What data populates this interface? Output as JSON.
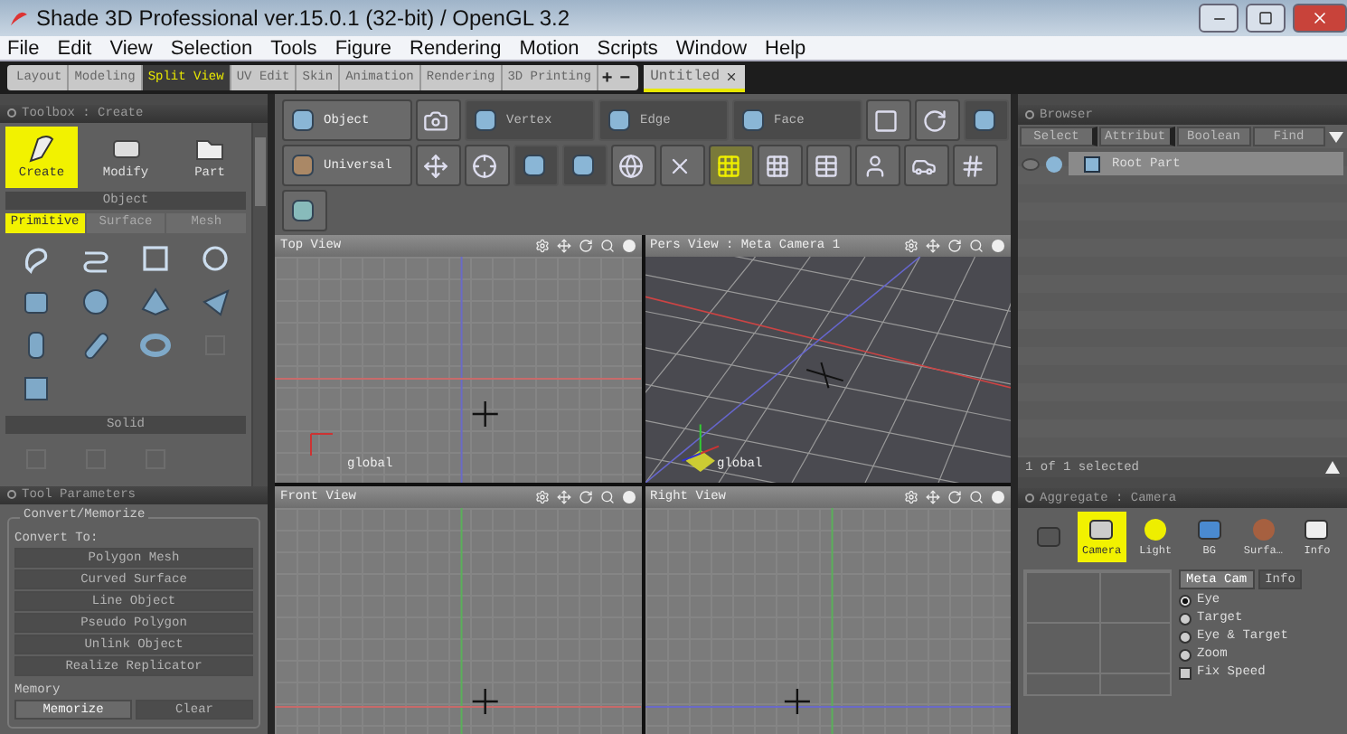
{
  "window": {
    "title": "Shade 3D Professional ver.15.0.1 (32-bit) / OpenGL 3.2"
  },
  "menu": [
    "File",
    "Edit",
    "View",
    "Selection",
    "Tools",
    "Figure",
    "Rendering",
    "Motion",
    "Scripts",
    "Window",
    "Help"
  ],
  "layout_tabs": [
    {
      "label": "Layout",
      "selected": false
    },
    {
      "label": "Modeling",
      "selected": false
    },
    {
      "label": "Split View",
      "selected": true
    },
    {
      "label": "UV Edit",
      "selected": false
    },
    {
      "label": "Skin",
      "selected": false
    },
    {
      "label": "Animation",
      "selected": false
    },
    {
      "label": "Rendering",
      "selected": false
    },
    {
      "label": "3D Printing",
      "selected": false
    }
  ],
  "layout_tab_actions": [
    "+",
    "−"
  ],
  "document_tabs": [
    {
      "label": "Untitled",
      "selected": true
    }
  ],
  "toolbox": {
    "title": "Toolbox : Create",
    "modes": [
      {
        "label": "Create",
        "selected": true
      },
      {
        "label": "Modify",
        "selected": false
      },
      {
        "label": "Part",
        "selected": false
      }
    ],
    "section": "Object",
    "subtabs": [
      {
        "label": "Primitive",
        "selected": true
      },
      {
        "label": "Surface",
        "selected": false
      },
      {
        "label": "Mesh",
        "selected": false
      }
    ],
    "tools": [
      {
        "disabled": false
      },
      {
        "disabled": false
      },
      {
        "disabled": false
      },
      {
        "disabled": false
      },
      {
        "disabled": false
      },
      {
        "disabled": false
      },
      {
        "disabled": false
      },
      {
        "disabled": false
      },
      {
        "disabled": false
      },
      {
        "disabled": false
      },
      {
        "disabled": false
      },
      {
        "disabled": true
      },
      {
        "disabled": false
      }
    ],
    "solid_section": "Solid",
    "solid_tools": [
      {
        "disabled": true
      },
      {
        "disabled": true
      },
      {
        "disabled": true
      }
    ]
  },
  "tool_parameters": {
    "title": "Tool Parameters",
    "group": "Convert/Memorize",
    "convert_label": "Convert To:",
    "convert_buttons": [
      {
        "label": "Polygon Mesh",
        "disabled": true
      },
      {
        "label": "Curved Surface",
        "disabled": true
      },
      {
        "label": "Line Object",
        "disabled": true
      },
      {
        "label": "Pseudo Polygon",
        "disabled": true
      },
      {
        "label": "Unlink Object",
        "disabled": true
      },
      {
        "label": "Realize Replicator",
        "disabled": true
      }
    ],
    "memory_label": "Memory",
    "memory_buttons": [
      {
        "label": "Memorize",
        "disabled": false
      },
      {
        "label": "Clear",
        "disabled": true
      }
    ]
  },
  "toolbar_rows": [
    [
      {
        "label": "Object",
        "disabled": false,
        "selected": false
      },
      {
        "disabled": false,
        "selected": false
      },
      {
        "label": "Vertex",
        "disabled": true,
        "selected": false
      },
      {
        "label": "Edge",
        "disabled": true,
        "selected": false
      },
      {
        "label": "Face",
        "disabled": true,
        "selected": false
      },
      {
        "disabled": false,
        "selected": false
      },
      {
        "disabled": false,
        "selected": false
      },
      {
        "disabled": true,
        "selected": false
      }
    ],
    [
      {
        "label": "Universal",
        "disabled": false,
        "selected": false
      },
      {
        "disabled": false,
        "selected": false
      },
      {
        "disabled": false,
        "selected": false
      },
      {
        "disabled": true,
        "selected": false
      },
      {
        "disabled": true,
        "selected": false
      },
      {
        "disabled": false,
        "selected": false
      },
      {
        "disabled": false,
        "selected": false
      },
      {
        "disabled": false,
        "selected": true
      },
      {
        "disabled": false,
        "selected": false
      },
      {
        "disabled": false,
        "selected": false
      },
      {
        "disabled": false,
        "selected": false
      },
      {
        "disabled": false,
        "selected": false
      },
      {
        "disabled": false,
        "selected": false
      }
    ],
    [
      {
        "disabled": false,
        "selected": false
      }
    ]
  ],
  "viewports": [
    {
      "title": "Top View",
      "kind": "top",
      "axis_label": "global"
    },
    {
      "title": "Pers View : Meta Camera 1",
      "kind": "pers",
      "axis_label": "global"
    },
    {
      "title": "Front View",
      "kind": "front"
    },
    {
      "title": "Right View",
      "kind": "right"
    }
  ],
  "browser": {
    "title": "Browser",
    "tabs": [
      {
        "label": "Select",
        "menu": true
      },
      {
        "label": "Attribut",
        "menu": true
      },
      {
        "label": "Boolean",
        "menu": false
      },
      {
        "label": "Find",
        "menu": false
      }
    ],
    "items": [
      {
        "label": "Root Part",
        "selected": true
      }
    ],
    "status": "1 of 1 selected"
  },
  "aggregate": {
    "title": "Aggregate : Camera",
    "tabs": [
      {
        "selected": false
      },
      {
        "label": "Camera",
        "selected": true
      },
      {
        "label": "Light",
        "selected": false
      },
      {
        "label": "BG",
        "selected": false
      },
      {
        "label": "Surfa…",
        "selected": false
      },
      {
        "label": "Info",
        "selected": false
      }
    ],
    "camera_menu": "Meta Cam",
    "info_menu": "Info",
    "modes": [
      {
        "label": "Eye",
        "selected": true
      },
      {
        "label": "Target",
        "selected": false
      },
      {
        "label": "Eye & Target",
        "selected": false
      },
      {
        "label": "Zoom",
        "selected": false
      }
    ],
    "options": [
      {
        "label": "Fix Speed",
        "checked": false
      }
    ]
  }
}
